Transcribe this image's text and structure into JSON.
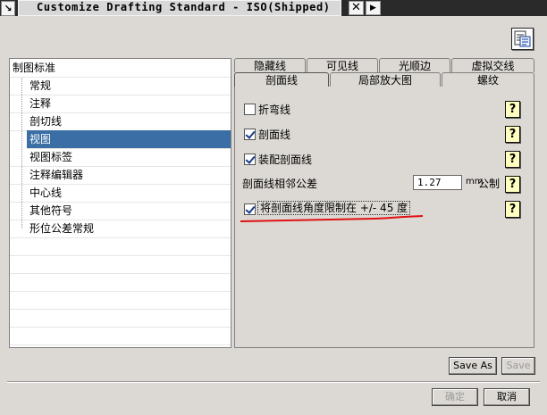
{
  "window": {
    "title": "Customize Drafting Standard - ISO(Shipped)",
    "menu_icon": "↘",
    "close_glyph": "✕",
    "arrow_glyph": "▶"
  },
  "tree": {
    "root": "制图标准",
    "items": [
      {
        "label": "常规",
        "selected": false
      },
      {
        "label": "注释",
        "selected": false
      },
      {
        "label": "剖切线",
        "selected": false
      },
      {
        "label": "视图",
        "selected": true
      },
      {
        "label": "视图标签",
        "selected": false
      },
      {
        "label": "注释编辑器",
        "selected": false
      },
      {
        "label": "中心线",
        "selected": false
      },
      {
        "label": "其他符号",
        "selected": false
      },
      {
        "label": "形位公差常规",
        "selected": false
      }
    ]
  },
  "tabs": {
    "row1": [
      "隐藏线",
      "可见线",
      "光顺边",
      "虚拟交线"
    ],
    "row2": [
      "剖面线",
      "局部放大图",
      "螺纹"
    ],
    "active": "剖面线"
  },
  "panel": {
    "options": [
      {
        "label": "折弯线",
        "checked": false
      },
      {
        "label": "剖面线",
        "checked": true
      },
      {
        "label": "装配剖面线",
        "checked": true
      }
    ],
    "tolerance_label": "剖面线相邻公差",
    "tolerance_value": "1.27",
    "tolerance_unit": "mm",
    "tolerance_suffix": "公制",
    "limit_label": "将剖面线角度限制在 +/- 45 度",
    "limit_checked": true,
    "help_glyph": "?"
  },
  "buttons": {
    "save_as": "Save As",
    "save": "Save",
    "ok": "确定",
    "cancel": "取消"
  },
  "colors": {
    "selection": "#3a6ea5",
    "annotation_underline": "#e01010",
    "help_bg": "#ffffc0"
  }
}
